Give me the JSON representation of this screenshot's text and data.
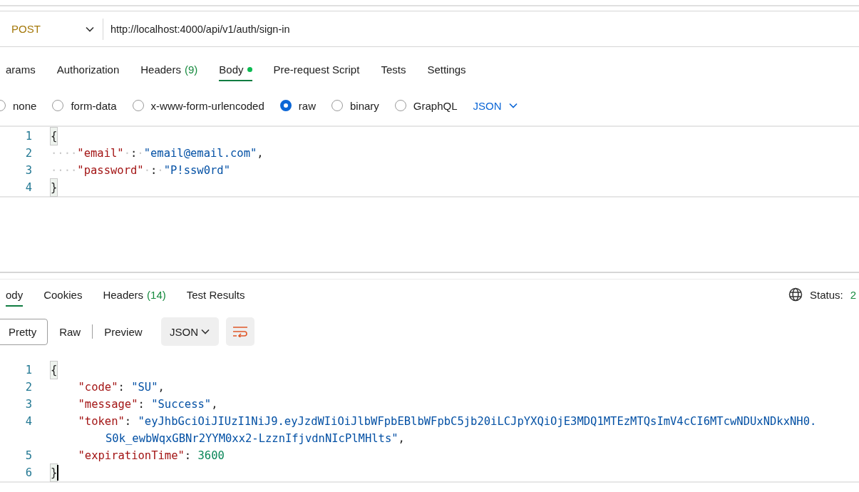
{
  "request": {
    "method": "POST",
    "url": "http://localhost:4000/api/v1/auth/sign-in"
  },
  "request_tabs": [
    {
      "label": "arams",
      "selected": false
    },
    {
      "label": "Authorization",
      "selected": false
    },
    {
      "label": "Headers",
      "count": "(9)",
      "selected": false
    },
    {
      "label": "Body",
      "selected": true,
      "dot": true
    },
    {
      "label": "Pre-request Script",
      "selected": false
    },
    {
      "label": "Tests",
      "selected": false
    },
    {
      "label": "Settings",
      "selected": false
    }
  ],
  "body_types": [
    {
      "label": "none",
      "selected": false
    },
    {
      "label": "form-data",
      "selected": false
    },
    {
      "label": "x-www-form-urlencoded",
      "selected": false
    },
    {
      "label": "raw",
      "selected": true
    },
    {
      "label": "binary",
      "selected": false
    },
    {
      "label": "GraphQL",
      "selected": false
    }
  ],
  "body_format": "JSON",
  "request_body": [
    {
      "number": "1",
      "tokens": [
        {
          "kind": "brace",
          "text": "{"
        }
      ]
    },
    {
      "number": "2",
      "tokens": [
        {
          "kind": "ws",
          "text": "····"
        },
        {
          "kind": "key",
          "text": "\"email\""
        },
        {
          "kind": "ws",
          "text": "·"
        },
        {
          "kind": "punct",
          "text": ":"
        },
        {
          "kind": "ws",
          "text": "·"
        },
        {
          "kind": "string",
          "text": "\"email@email.com\""
        },
        {
          "kind": "punct",
          "text": ","
        }
      ]
    },
    {
      "number": "3",
      "tokens": [
        {
          "kind": "ws",
          "text": "····"
        },
        {
          "kind": "key",
          "text": "\"password\""
        },
        {
          "kind": "ws",
          "text": "·"
        },
        {
          "kind": "punct",
          "text": ":"
        },
        {
          "kind": "ws",
          "text": "·"
        },
        {
          "kind": "string",
          "text": "\"P!ssw0rd\""
        }
      ]
    },
    {
      "number": "4",
      "tokens": [
        {
          "kind": "brace",
          "text": "}"
        }
      ]
    }
  ],
  "response_tabs": [
    {
      "label": "ody",
      "selected": true
    },
    {
      "label": "Cookies",
      "selected": false
    },
    {
      "label": "Headers",
      "count": "(14)",
      "selected": false
    },
    {
      "label": "Test Results",
      "selected": false
    }
  ],
  "status": {
    "label": "Status:",
    "value": "2"
  },
  "view_modes": [
    {
      "label": "Pretty",
      "selected": true
    },
    {
      "label": "Raw",
      "selected": false
    },
    {
      "label": "Preview",
      "selected": false
    }
  ],
  "response_format": "JSON",
  "response_body": [
    {
      "number": "1",
      "tokens": [
        {
          "kind": "brace",
          "text": "{"
        }
      ]
    },
    {
      "number": "2",
      "indented": true,
      "tokens": [
        {
          "kind": "key",
          "text": "\"code\""
        },
        {
          "kind": "punct",
          "text": ": "
        },
        {
          "kind": "string",
          "text": "\"SU\""
        },
        {
          "kind": "punct",
          "text": ","
        }
      ]
    },
    {
      "number": "3",
      "indented": true,
      "tokens": [
        {
          "kind": "key",
          "text": "\"message\""
        },
        {
          "kind": "punct",
          "text": ": "
        },
        {
          "kind": "string",
          "text": "\"Success\""
        },
        {
          "kind": "punct",
          "text": ","
        }
      ]
    },
    {
      "number": "4",
      "indented": true,
      "tokens": [
        {
          "kind": "key",
          "text": "\"token\""
        },
        {
          "kind": "punct",
          "text": ": "
        },
        {
          "kind": "string",
          "text": "\"eyJhbGciOiJIUzI1NiJ9.eyJzdWIiOiJlbWFpbEBlbWFpbC5jb20iLCJpYXQiOjE3MDQ1MTEzMTQsImV4cCI6MTcwNDUxNDkxNH0."
        }
      ],
      "continuation": [
        {
          "kind": "string",
          "text": "S0k_ewbWqxGBNr2YYM0xx2-LzznIfjvdnNIcPlMHlts\""
        },
        {
          "kind": "punct",
          "text": ","
        }
      ]
    },
    {
      "number": "5",
      "indented": true,
      "tokens": [
        {
          "kind": "key",
          "text": "\"expirationTime\""
        },
        {
          "kind": "punct",
          "text": ": "
        },
        {
          "kind": "number",
          "text": "3600"
        }
      ]
    },
    {
      "number": "6",
      "tokens": [
        {
          "kind": "brace",
          "text": "}"
        }
      ],
      "cursor": true
    }
  ]
}
